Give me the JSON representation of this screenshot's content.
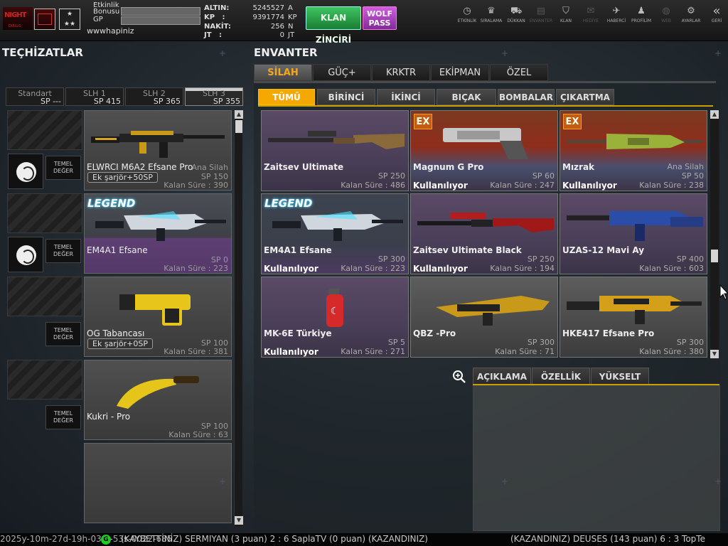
{
  "player": {
    "level_label": "Etkinlik\nBonusu",
    "gp_label": "GP",
    "name": "wwwhapiniz"
  },
  "currencies": [
    {
      "label": "ALTIN:",
      "value": "5245527",
      "unit": "A"
    },
    {
      "label": "KP   :",
      "value": "9391774",
      "unit": "KP"
    },
    {
      "label": "NAKİT:",
      "value": "256",
      "unit": "N"
    },
    {
      "label": "JT   :",
      "value": "0",
      "unit": "JT"
    }
  ],
  "buttons": {
    "klan": "KLAN ZİNCİRİ",
    "wolf_line1": "WOLF",
    "wolf_line2": "PASS"
  },
  "topnav": [
    {
      "label": "ETKİNLİK",
      "icon": "stopwatch-icon",
      "glyph": "◷"
    },
    {
      "label": "SIRALAMA",
      "icon": "rank-icon",
      "glyph": "♛"
    },
    {
      "label": "DÜKKAN",
      "icon": "cart-icon",
      "glyph": "⛟"
    },
    {
      "label": "ENVANTER",
      "icon": "inventory-icon",
      "glyph": "▤"
    },
    {
      "label": "KLAN",
      "icon": "shield-icon",
      "glyph": "⛉"
    },
    {
      "label": "HEDİYE",
      "icon": "gift-icon",
      "glyph": "✉"
    },
    {
      "label": "HABERCİ",
      "icon": "megaphone-icon",
      "glyph": "📢"
    },
    {
      "label": "PROFİLİM",
      "icon": "profile-icon",
      "glyph": "♟"
    },
    {
      "label": "WEB",
      "icon": "globe-icon",
      "glyph": "◍"
    },
    {
      "label": "AYARLAR",
      "icon": "gear-icon",
      "glyph": "⚙"
    },
    {
      "label": "GERİ",
      "icon": "back-icon",
      "glyph": "«"
    }
  ],
  "left": {
    "title": "TEÇHİZATLAR",
    "slot_tabs": [
      {
        "name": "Standart",
        "sp": "SP ---"
      },
      {
        "name": "SLH 1",
        "sp": "SP 415"
      },
      {
        "name": "SLH 2",
        "sp": "SP 365"
      },
      {
        "name": "SLH 3",
        "sp": "SP 355"
      }
    ],
    "temel": "TEMEL\nDEĞER",
    "items": [
      {
        "name": "ELWRCI M6A2 Efsane Pro",
        "category": "Ana Silah",
        "sp": "SP 150",
        "remaining": "Kalan Süre : 390",
        "ammo": "Ek şarjör+50SP"
      },
      {
        "name": "EM4A1 Efsane",
        "category": "",
        "sp": "SP 0",
        "remaining": "Kalan Süre : 223",
        "ammo": ""
      },
      {
        "name": "OG Tabancası",
        "category": "",
        "sp": "SP 100",
        "remaining": "Kalan Süre : 381",
        "ammo": "Ek şarjör+0SP"
      },
      {
        "name": "Kukri - Pro",
        "category": "",
        "sp": "SP 100",
        "remaining": "Kalan Süre : 63",
        "ammo": ""
      }
    ]
  },
  "right": {
    "title": "ENVANTER",
    "main_tabs": [
      "SİLAH",
      "GÜÇ+",
      "KRKTR",
      "EKİPMAN",
      "ÖZEL"
    ],
    "sub_tabs": [
      "TÜMÜ",
      "BİRİNCİ",
      "İKİNCİ",
      "BIÇAK",
      "BOMBALAR",
      "ÇIKARTMA"
    ],
    "badge_ex": "EX",
    "badge_legend": "LEGEND",
    "in_use": "Kullanılıyor",
    "items": [
      {
        "name": "Zaitsev Ultimate",
        "category": "",
        "sp": "SP 250",
        "remaining": "Kalan Süre : 486",
        "in_use": ""
      },
      {
        "name": "Magnum G Pro",
        "category": "",
        "sp": "SP 60",
        "remaining": "Kalan Süre : 247",
        "in_use": "Kullanılıyor"
      },
      {
        "name": "Mızrak",
        "category": "Ana Silah",
        "sp": "SP 50",
        "remaining": "Kalan Süre : 238",
        "in_use": "Kullanılıyor"
      },
      {
        "name": "EM4A1 Efsane",
        "category": "",
        "sp": "SP 300",
        "remaining": "Kalan Süre : 223",
        "in_use": "Kullanılıyor"
      },
      {
        "name": "Zaitsev Ultimate Black",
        "category": "",
        "sp": "SP 250",
        "remaining": "Kalan Süre : 194",
        "in_use": "Kullanılıyor"
      },
      {
        "name": "UZAS-12 Mavi Ay",
        "category": "",
        "sp": "SP 400",
        "remaining": "Kalan Süre : 603",
        "in_use": ""
      },
      {
        "name": "MK-6E Türkiye",
        "category": "",
        "sp": "SP 5",
        "remaining": "Kalan Süre : 271",
        "in_use": "Kullanılıyor"
      },
      {
        "name": "QBZ -Pro",
        "category": "",
        "sp": "SP 300",
        "remaining": "Kalan Süre : 71",
        "in_use": ""
      },
      {
        "name": "HKE417 Efsane Pro",
        "category": "",
        "sp": "SP 300",
        "remaining": "Kalan Süre : 380",
        "in_use": ""
      }
    ],
    "detail_tabs": [
      "AÇIKLAMA",
      "ÖZELLİK",
      "YÜKSELT"
    ]
  },
  "ticker": {
    "timestamp": "2025y-10m-27d-19h-03m-53s-0022-685",
    "icon_glyph": "G",
    "msg1": "(KAYBETTİNİZ) SERMIYAN (3 puan) 2 : 6 SaplaTV (0 puan) (KAZANDINIZ)",
    "msg2": "(KAZANDINIZ) DEUSES (143 puan) 6 : 3 TopTe"
  }
}
